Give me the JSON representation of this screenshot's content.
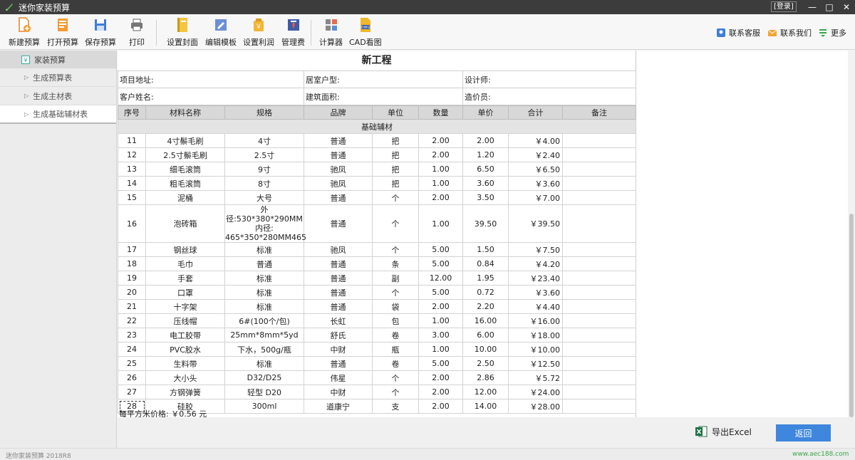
{
  "window": {
    "title": "迷你家装预算",
    "login": "[登录]",
    "min": "—",
    "max": "□",
    "close": "✕"
  },
  "toolbar": {
    "new": "新建预算",
    "open": "打开预算",
    "save": "保存预算",
    "print": "打印",
    "cover": "设置封面",
    "edit_template": "编辑模板",
    "profit": "设置利润",
    "management_fee": "管理费",
    "calculator": "计算器",
    "cad": "CAD看图",
    "service": "联系客服",
    "contact": "联系我们",
    "more": "更多"
  },
  "sidebar": {
    "root": "家装预算",
    "items": [
      {
        "label": "生成预算表"
      },
      {
        "label": "生成主材表"
      },
      {
        "label": "生成基础辅材表"
      }
    ]
  },
  "sheet": {
    "title": "新工程",
    "info": {
      "address": "项目地址:",
      "house_type": "居室户型:",
      "designer": "设计师:",
      "customer": "客户姓名:",
      "area": "建筑面积:",
      "estimator": "造价员:"
    },
    "columns": [
      "序号",
      "材料名称",
      "规格",
      "品牌",
      "单位",
      "数量",
      "单价",
      "合计",
      "备注"
    ],
    "category": "基础辅材",
    "rows": [
      {
        "no": "11",
        "name": "4寸鬃毛刷",
        "spec": "4寸",
        "brand": "普通",
        "unit": "把",
        "qty": "2.00",
        "price": "2.00",
        "total": "￥4.00",
        "note": ""
      },
      {
        "no": "12",
        "name": "2.5寸鬃毛刷",
        "spec": "2.5寸",
        "brand": "普通",
        "unit": "把",
        "qty": "2.00",
        "price": "1.20",
        "total": "￥2.40",
        "note": ""
      },
      {
        "no": "13",
        "name": "细毛滚筒",
        "spec": "9寸",
        "brand": "驰凤",
        "unit": "把",
        "qty": "1.00",
        "price": "6.50",
        "total": "￥6.50",
        "note": ""
      },
      {
        "no": "14",
        "name": "粗毛滚筒",
        "spec": "8寸",
        "brand": "驰凤",
        "unit": "把",
        "qty": "1.00",
        "price": "3.60",
        "total": "￥3.60",
        "note": ""
      },
      {
        "no": "15",
        "name": "泥桶",
        "spec": "大号",
        "brand": "普通",
        "unit": "个",
        "qty": "2.00",
        "price": "3.50",
        "total": "￥7.00",
        "note": ""
      },
      {
        "no": "16",
        "name": "泡砖箱",
        "spec_lines": [
          "外径:530*380*290MM",
          "内径:",
          "465*350*280MM465"
        ],
        "brand": "普通",
        "unit": "个",
        "qty": "1.00",
        "price": "39.50",
        "total": "￥39.50",
        "note": ""
      },
      {
        "no": "17",
        "name": "钢丝球",
        "spec": "标准",
        "brand": "驰凤",
        "unit": "个",
        "qty": "5.00",
        "price": "1.50",
        "total": "￥7.50",
        "note": ""
      },
      {
        "no": "18",
        "name": "毛巾",
        "spec": "普通",
        "brand": "普通",
        "unit": "条",
        "qty": "5.00",
        "price": "0.84",
        "total": "￥4.20",
        "note": ""
      },
      {
        "no": "19",
        "name": "手套",
        "spec": "标准",
        "brand": "普通",
        "unit": "副",
        "qty": "12.00",
        "price": "1.95",
        "total": "￥23.40",
        "note": ""
      },
      {
        "no": "20",
        "name": "口罩",
        "spec": "标准",
        "brand": "普通",
        "unit": "个",
        "qty": "5.00",
        "price": "0.72",
        "total": "￥3.60",
        "note": ""
      },
      {
        "no": "21",
        "name": "十字架",
        "spec": "标准",
        "brand": "普通",
        "unit": "袋",
        "qty": "2.00",
        "price": "2.20",
        "total": "￥4.40",
        "note": ""
      },
      {
        "no": "22",
        "name": "压线帽",
        "spec": "6#(100个/包)",
        "brand": "长虹",
        "unit": "包",
        "qty": "1.00",
        "price": "16.00",
        "total": "￥16.00",
        "note": ""
      },
      {
        "no": "23",
        "name": "电工胶带",
        "spec": "25mm*8mm*5yd",
        "brand": "舒氏",
        "unit": "卷",
        "qty": "3.00",
        "price": "6.00",
        "total": "￥18.00",
        "note": ""
      },
      {
        "no": "24",
        "name": "PVC胶水",
        "spec": "下水，500g/瓶",
        "brand": "中财",
        "unit": "瓶",
        "qty": "1.00",
        "price": "10.00",
        "total": "￥10.00",
        "note": ""
      },
      {
        "no": "25",
        "name": "生料带",
        "spec": "标准",
        "brand": "普通",
        "unit": "卷",
        "qty": "5.00",
        "price": "2.50",
        "total": "￥12.50",
        "note": ""
      },
      {
        "no": "26",
        "name": "大小头",
        "spec": "D32/D25",
        "brand": "伟星",
        "unit": "个",
        "qty": "2.00",
        "price": "2.86",
        "total": "￥5.72",
        "note": ""
      },
      {
        "no": "27",
        "name": "方钢弹簧",
        "spec": "轻型 D20",
        "brand": "中财",
        "unit": "个",
        "qty": "2.00",
        "price": "12.00",
        "total": "￥24.00",
        "note": ""
      },
      {
        "no": "28",
        "name": "硅胶",
        "spec": "300ml",
        "brand": "道康宁",
        "unit": "支",
        "qty": "2.00",
        "price": "14.00",
        "total": "￥28.00",
        "note": ""
      }
    ],
    "price_note": "每平方米价格: ￥0.56 元"
  },
  "actions": {
    "export": "导出Excel",
    "return": "返回"
  },
  "status": {
    "version": "迷你家装预算 2018R8",
    "site": "www.aec188.com"
  },
  "colors": {
    "titlebar": "#3c3c3c",
    "accent_blue": "#3f86dd",
    "excel_green": "#1e7145",
    "header_gray": "#d8d8d8"
  }
}
